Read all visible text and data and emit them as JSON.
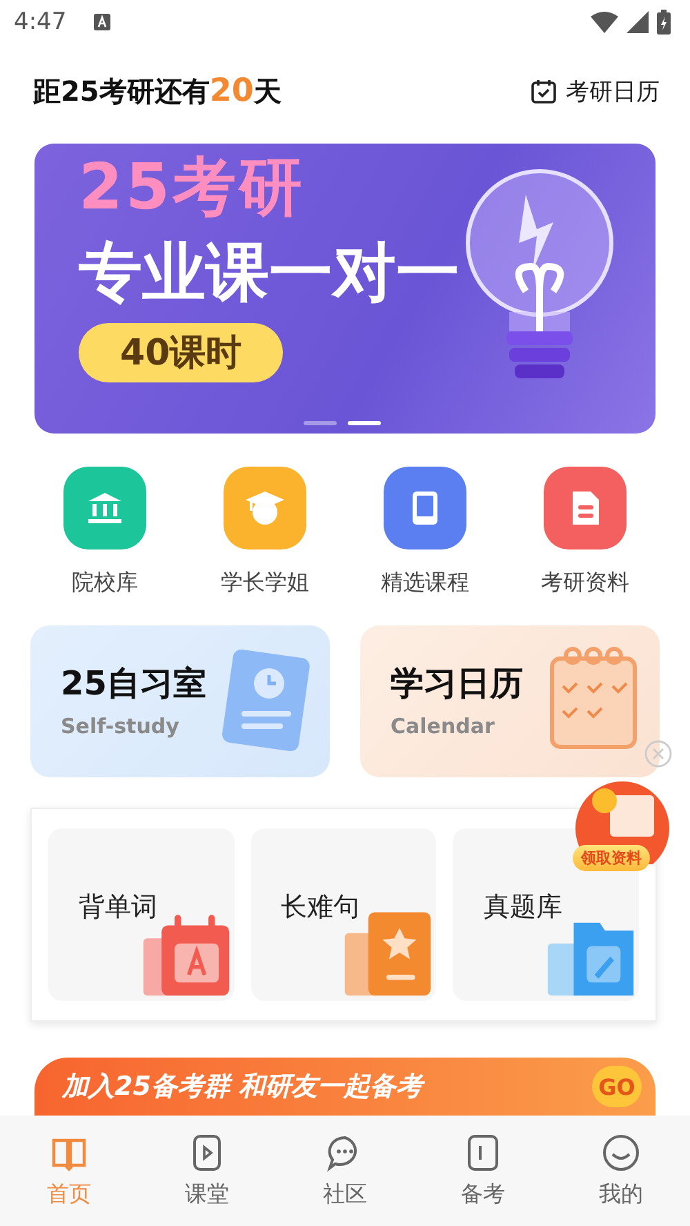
{
  "status_bar": {
    "time": "4:47"
  },
  "header": {
    "countdown_prefix": "距25考研还有",
    "countdown_days": "20",
    "countdown_suffix": "天",
    "calendar_link": "考研日历"
  },
  "banner": {
    "line_1": "25考研",
    "line_2": "专业课一对一",
    "pill": "40课时",
    "dots": [
      {
        "selected": false
      },
      {
        "selected": true
      }
    ]
  },
  "shortcuts": [
    {
      "label": "院校库",
      "kind": "school",
      "color": "#1cc59a"
    },
    {
      "label": "学长学姐",
      "kind": "graduate",
      "color": "#fbb22c"
    },
    {
      "label": "精选课程",
      "kind": "book",
      "color": "#5b7ff0"
    },
    {
      "label": "考研资料",
      "kind": "document",
      "color": "#f45f5f"
    }
  ],
  "feature_cards": [
    {
      "title": "25自习室",
      "subtitle": "Self-study",
      "kind": "study"
    },
    {
      "title": "学习日历",
      "subtitle": "Calendar",
      "kind": "calendar"
    }
  ],
  "practice": [
    {
      "label": "背单词",
      "kind": "words"
    },
    {
      "label": "长难句",
      "kind": "sentences"
    },
    {
      "label": "真题库",
      "kind": "exams"
    }
  ],
  "floating_badge": {
    "label": "领取资料"
  },
  "promo": {
    "text": "加入25备考群 和研友一起备考",
    "button": "GO"
  },
  "tabs": [
    {
      "label": "首页",
      "kind": "home",
      "selected": true
    },
    {
      "label": "课堂",
      "kind": "class",
      "selected": false
    },
    {
      "label": "社区",
      "kind": "community",
      "selected": false
    },
    {
      "label": "备考",
      "kind": "prep",
      "selected": false
    },
    {
      "label": "我的",
      "kind": "me",
      "selected": false
    }
  ]
}
